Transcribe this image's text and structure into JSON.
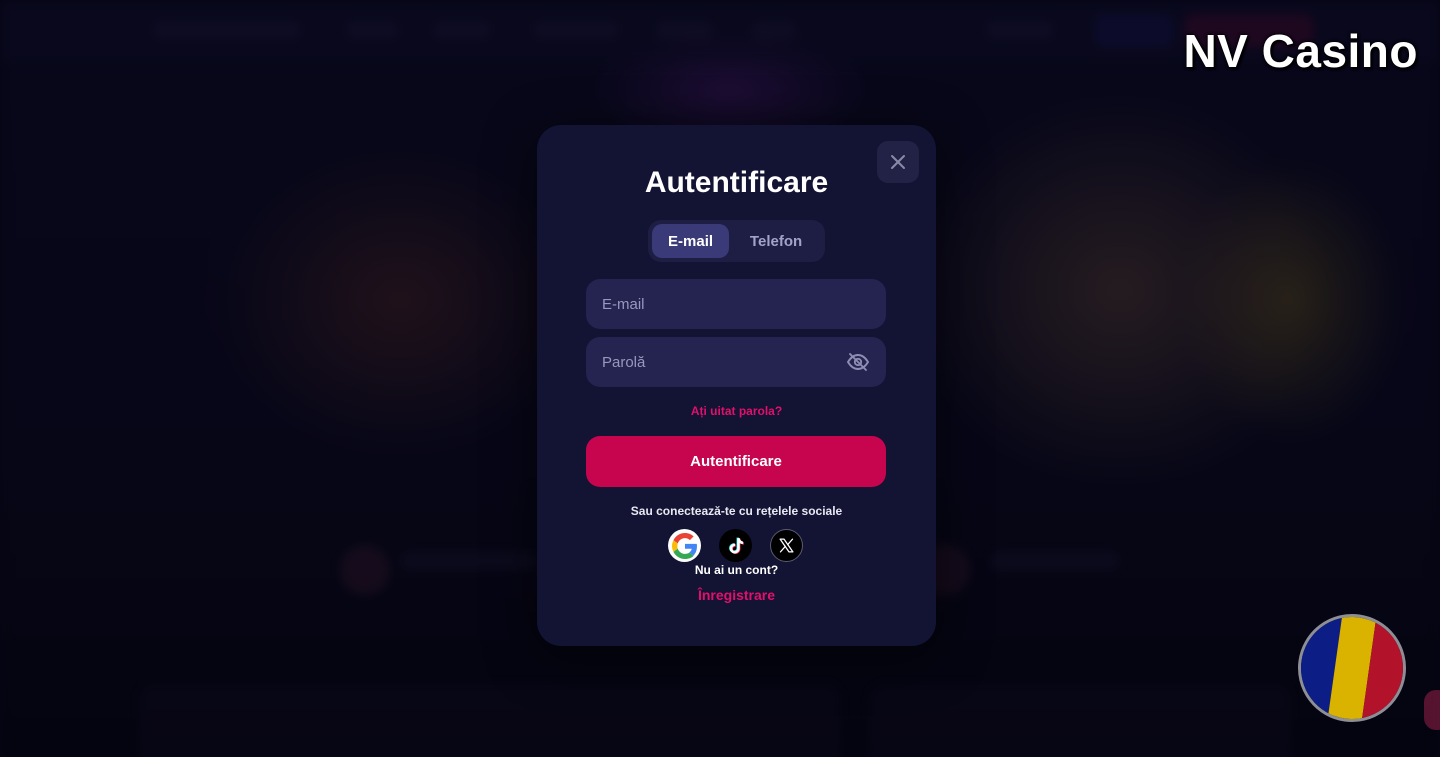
{
  "watermark": {
    "brand": "NV Casino"
  },
  "modal": {
    "title": "Autentificare",
    "tabs": [
      {
        "label": "E-mail",
        "active": true
      },
      {
        "label": "Telefon",
        "active": false
      }
    ],
    "email_field": {
      "placeholder": "E-mail",
      "value": ""
    },
    "password_field": {
      "placeholder": "Parolă",
      "value": ""
    },
    "forgot_link": "Ați uitat parola?",
    "submit_label": "Autentificare",
    "social_label": "Sau conectează-te cu rețelele sociale",
    "social_providers": [
      {
        "name": "Google",
        "icon": "google-icon"
      },
      {
        "name": "TikTok",
        "icon": "tiktok-icon"
      },
      {
        "name": "X",
        "icon": "x-icon"
      }
    ],
    "no_account_text": "Nu ai un cont?",
    "register_link": "Înregistrare"
  },
  "colors": {
    "modal_bg": "#131334",
    "accent": "#c7054f",
    "link": "#e2106b",
    "input_bg": "#25234f"
  },
  "language_flag": {
    "icon": "romania-flag-icon",
    "colors": [
      "#0c1e86",
      "#d9b300",
      "#b3132a"
    ]
  }
}
